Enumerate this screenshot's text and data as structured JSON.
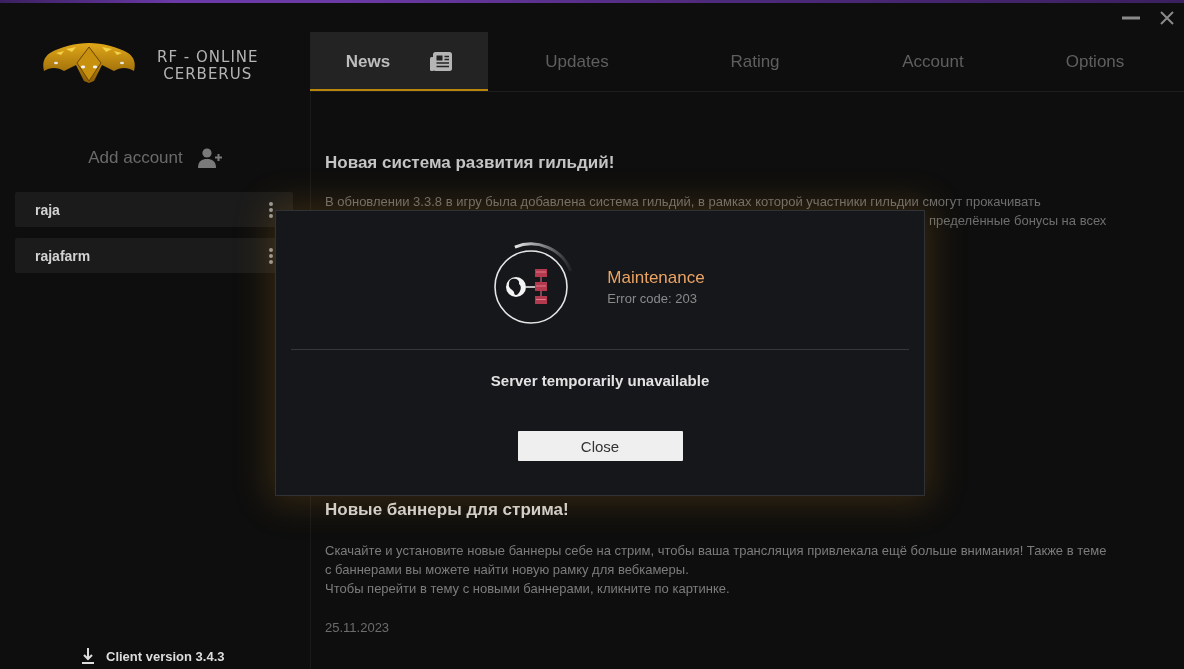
{
  "logo": {
    "title": "RF - ONLINE",
    "subtitle": "CERBERUS"
  },
  "tabs": [
    {
      "label": "News",
      "selected": true
    },
    {
      "label": "Updates",
      "selected": false
    },
    {
      "label": "Rating",
      "selected": false
    },
    {
      "label": "Account",
      "selected": false
    },
    {
      "label": "Options",
      "selected": false
    }
  ],
  "sidebar": {
    "add_account": "Add account",
    "accounts": [
      {
        "name": "raja"
      },
      {
        "name": "rajafarm"
      }
    ],
    "client_version": "Client version 3.4.3"
  },
  "news": [
    {
      "title": "Новая система развития гильдий!",
      "lines": [
        {
          "kind": "full",
          "text": "В обновлении 3.3.8 в игру была добавлена система гильдий, в рамках которой участники гильдии смогут прокачивать"
        },
        {
          "kind": "tail",
          "text": "пределённые бонусы на всех"
        }
      ]
    },
    {
      "title": "Новые баннеры для стрима!",
      "lines": [
        {
          "kind": "full",
          "text": "Скачайте и установите новые баннеры себе на стрим, чтобы ваша трансляция привлекала ещё больше внимания! Также в теме"
        },
        {
          "kind": "full",
          "text": "с баннерами вы можете найти новую рамку для вебкамеры."
        },
        {
          "kind": "full",
          "text": "Чтобы перейти в тему с новыми баннерами, кликните по картинке."
        }
      ],
      "date": "25.11.2023"
    }
  ],
  "dialog": {
    "title": "Maintenance",
    "error_code": "Error code: 203",
    "message": "Server temporarily unavailable",
    "button": "Close"
  }
}
